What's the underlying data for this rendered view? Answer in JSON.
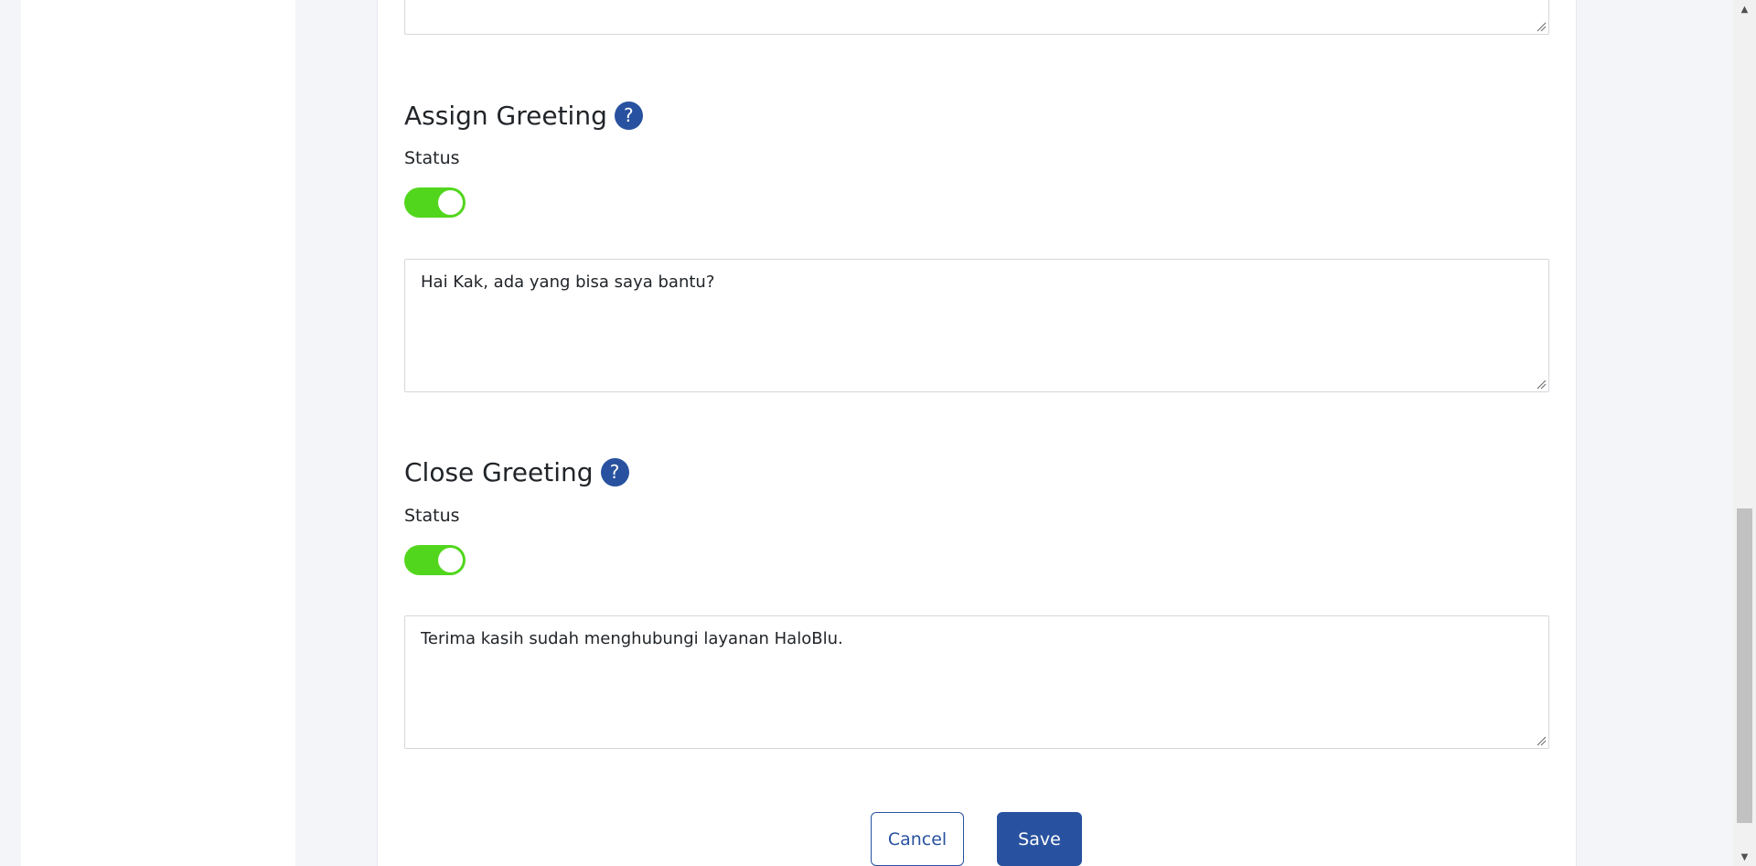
{
  "assign_greeting": {
    "title": "Assign Greeting",
    "help_icon": "question-icon",
    "status_label": "Status",
    "status_on": true,
    "message": "Hai Kak, ada yang bisa saya bantu?"
  },
  "close_greeting": {
    "title": "Close Greeting",
    "help_icon": "question-icon",
    "status_label": "Status",
    "status_on": true,
    "message": "Terima kasih sudah menghubungi layanan HaloBlu."
  },
  "actions": {
    "cancel_label": "Cancel",
    "save_label": "Save"
  },
  "colors": {
    "primary": "#28529f",
    "toggle_on": "#52d61d"
  },
  "icons": {
    "help": "?",
    "scroll_up": "▲",
    "scroll_down": "▼"
  }
}
